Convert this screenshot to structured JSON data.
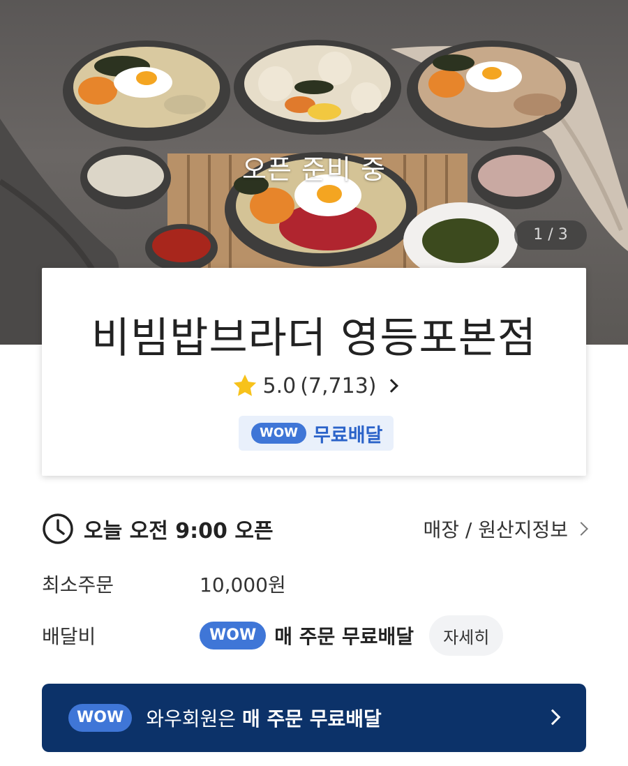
{
  "hero": {
    "status_overlay": "오픈 준비 중",
    "image_counter": "1 / 3",
    "image_alt": "bibimbap-dishes-photo"
  },
  "store": {
    "name": "비빔밥브라더 영등포본점",
    "rating": "5.0",
    "review_count": "(7,713)",
    "wow_badge": "WOW",
    "free_delivery_label": "무료배달"
  },
  "info": {
    "hours_text": "오늘 오전 9:00 오픈",
    "store_origin_link": "매장 / 원산지정보",
    "min_order_label": "최소주문",
    "min_order_value": "10,000원",
    "delivery_fee_label": "배달비",
    "delivery_fee_wow": "WOW",
    "delivery_fee_value": "매 주문 무료배달",
    "detail_button": "자세히"
  },
  "banner": {
    "wow_badge": "WOW",
    "text_prefix": "와우회원은 ",
    "text_bold": "매 주문 무료배달"
  },
  "colors": {
    "wow_blue": "#3f76d7",
    "banner_navy": "#0c3269",
    "wow_free_bg": "#e9f0fb",
    "star_yellow": "#f7c21b"
  }
}
